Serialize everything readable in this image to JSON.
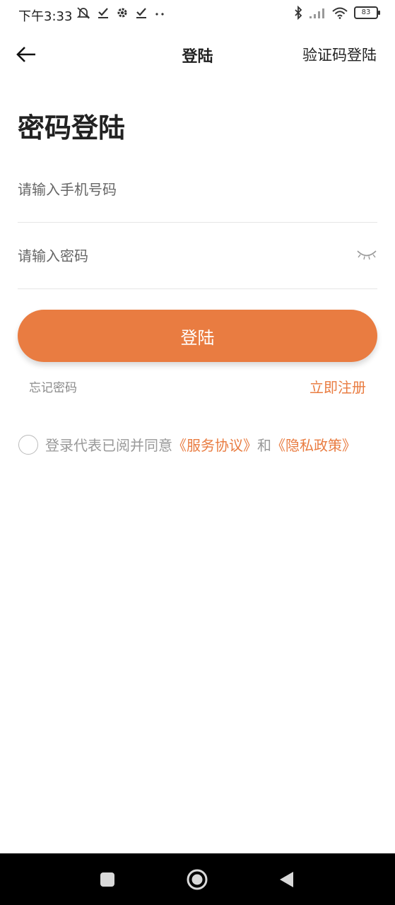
{
  "status_bar": {
    "time": "下午3:33",
    "battery": "83",
    "icons": [
      "mute-bell-icon",
      "check-icon",
      "gear-icon",
      "check-icon",
      "dots-icon",
      "bluetooth-icon",
      "signal-icon",
      "wifi-icon",
      "battery-icon"
    ]
  },
  "header": {
    "title": "登陆",
    "switch_label": "验证码登陆"
  },
  "heading": "密码登陆",
  "form": {
    "phone_placeholder": "请输入手机号码",
    "password_placeholder": "请输入密码",
    "login_label": "登陆",
    "forgot_label": "忘记密码",
    "register_label": "立即注册"
  },
  "agreement": {
    "prefix": "登录代表已阅并同意",
    "service_link": "《服务协议》",
    "conjunction": "和",
    "privacy_link": "《隐私政策》"
  },
  "colors": {
    "accent": "#e97c41",
    "nav_bar": "#000000"
  }
}
